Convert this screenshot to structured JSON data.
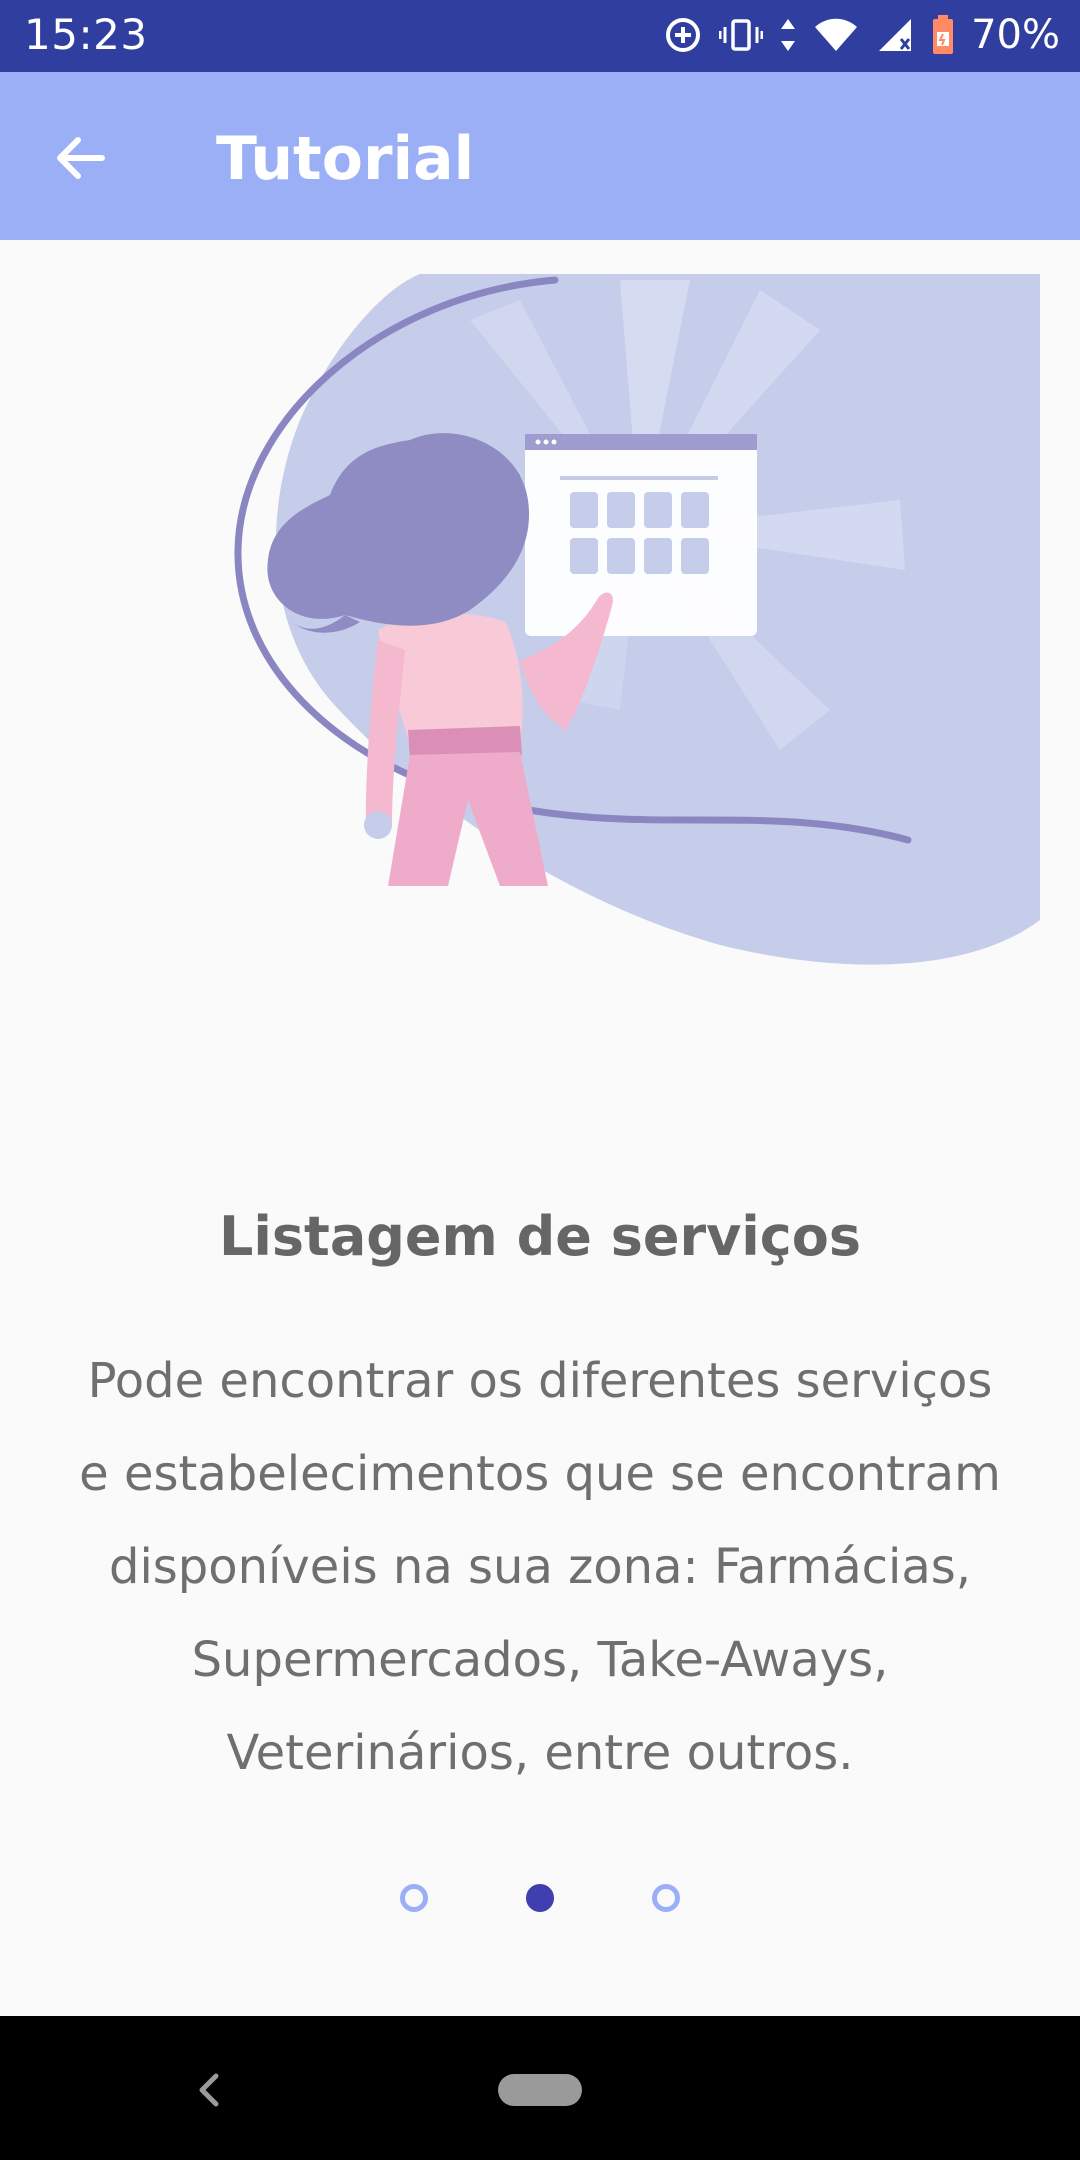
{
  "status_bar": {
    "time": "15:23",
    "battery": "70%",
    "icons": [
      "data-saver-icon",
      "vibrate-icon",
      "data-arrows-icon",
      "wifi-icon",
      "signal-icon",
      "battery-icon"
    ]
  },
  "app_bar": {
    "title": "Tutorial",
    "back_icon": "arrow-back-icon"
  },
  "slide": {
    "title": "Listagem de serviços",
    "body": "Pode encontrar os diferentes serviços e estabelecimentos que se encontram disponíveis na sua zona: Farmácias, Supermercados, Take-Aways, Veterinários, entre outros.",
    "illustration": "woman-browsing-services-illustration"
  },
  "pager": {
    "total": 3,
    "active_index": 1
  },
  "colors": {
    "status_bar": "#303f9f",
    "app_bar": "#9aaff5",
    "accent": "#3f3fb0",
    "text": "#6f6f6f"
  }
}
